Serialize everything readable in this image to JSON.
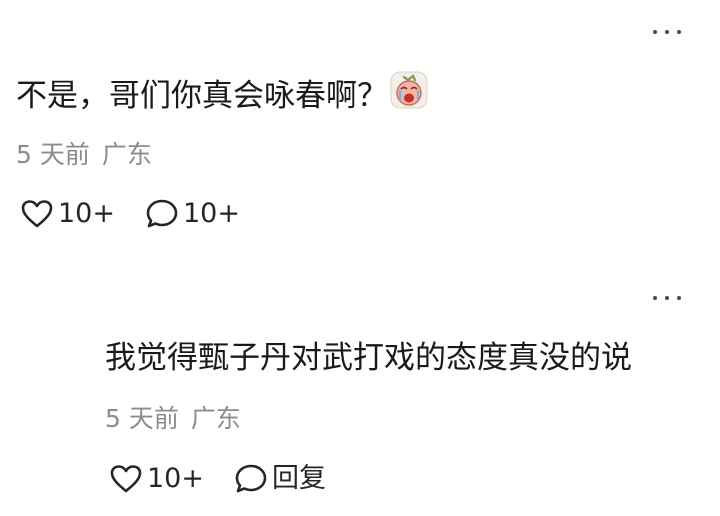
{
  "comments": [
    {
      "text": "不是，哥们你真会咏春啊？",
      "emoji": "crying-face-emoji",
      "time": "5 天前",
      "location": "广东",
      "likes": "10+",
      "replies": "10+"
    },
    {
      "text": "我觉得甄子丹对武打戏的态度真没的说",
      "time": "5 天前",
      "location": "广东",
      "likes": "10+",
      "reply_label": "回复"
    }
  ],
  "colors": {
    "text": "#1a1a1a",
    "meta": "#8c8c8c",
    "icon": "#262626"
  }
}
